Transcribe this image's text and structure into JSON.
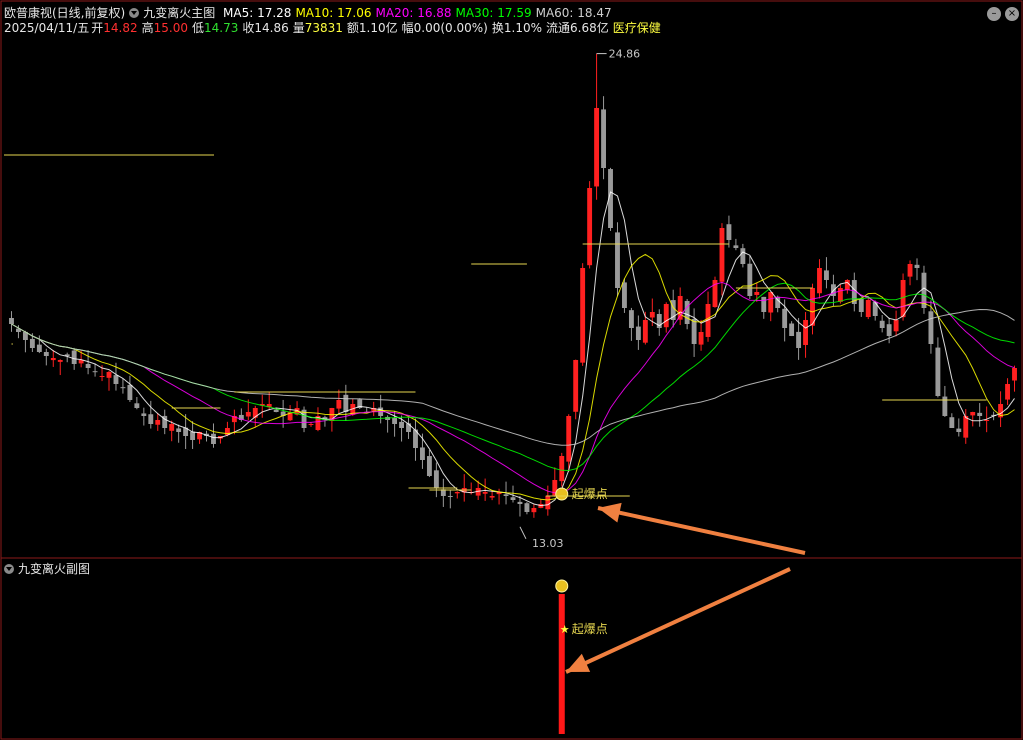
{
  "header": {
    "stock_name": "欧普康视(日线,前复权)",
    "indicator": "九变离火主图",
    "ma": [
      {
        "label": "MA5: 17.28",
        "color": "#ffffff"
      },
      {
        "label": "MA10: 17.06",
        "color": "#ffff00"
      },
      {
        "label": "MA20: 16.88",
        "color": "#ff00ff"
      },
      {
        "label": "MA30: 17.59",
        "color": "#00ff00"
      },
      {
        "label": "MA60: 18.47",
        "color": "#cfcfcf"
      }
    ],
    "date": "2025/04/11/五",
    "open_label": "开",
    "open": "14.82",
    "high_label": "高",
    "high": "15.00",
    "low_label": "低",
    "low": "14.73",
    "close_label": "收",
    "close": "14.86",
    "vol_label": "量",
    "vol": "73831",
    "amount": "额1.10亿",
    "change": "幅0.00(0.00%)",
    "turnover": "换1.10%",
    "float": "流通6.68亿",
    "sector": "医疗保健"
  },
  "sub_header": {
    "indicator": "九变离火副图"
  },
  "colors": {
    "up": "#ff2020",
    "down": "#9a9a9a",
    "level": "#e6d650",
    "arrow": "#f08040",
    "grid": "#8b1a1a"
  },
  "annotations": {
    "high_value": "24.86",
    "low_value": "13.03",
    "signal_label": "起爆点",
    "signal_label_sub": "起爆点"
  },
  "chart_data": [
    {
      "type": "candlestick",
      "title": "九变离火主图",
      "ylim": [
        12.5,
        25.2
      ],
      "x": "trading days (~120 bars)",
      "series": [
        {
          "name": "MA5",
          "last": 17.28
        },
        {
          "name": "MA10",
          "last": 17.06
        },
        {
          "name": "MA20",
          "last": 16.88
        },
        {
          "name": "MA30",
          "last": 17.59
        },
        {
          "name": "MA60",
          "last": 18.47
        }
      ],
      "closes": [
        18.1,
        17.9,
        17.7,
        17.5,
        17.4,
        17.3,
        17.25,
        17.2,
        17.3,
        17.1,
        17.2,
        17.0,
        16.9,
        16.8,
        16.9,
        16.6,
        16.5,
        16.2,
        16.0,
        15.8,
        15.6,
        15.7,
        15.5,
        15.6,
        15.4,
        15.3,
        15.2,
        15.4,
        15.3,
        15.1,
        15.3,
        15.5,
        15.8,
        15.7,
        15.9,
        16.0,
        16.1,
        16.1,
        15.9,
        15.8,
        15.9,
        16.0,
        15.5,
        15.6,
        15.8,
        15.7,
        16.0,
        16.2,
        15.9,
        16.1,
        16.0,
        15.9,
        16.0,
        15.8,
        15.7,
        15.6,
        15.5,
        15.4,
        15.0,
        14.7,
        14.3,
        14.0,
        13.8,
        13.8,
        13.9,
        14.0,
        13.9,
        14.0,
        13.9,
        13.8,
        13.9,
        13.8,
        13.7,
        13.6,
        13.4,
        13.5,
        13.6,
        13.8,
        14.2,
        14.8,
        15.8,
        17.2,
        19.5,
        21.5,
        23.5,
        22.0,
        20.5,
        19.0,
        18.5,
        18.0,
        17.7,
        18.2,
        18.4,
        18.0,
        18.6,
        18.2,
        18.8,
        18.1,
        17.6,
        17.9,
        18.6,
        19.2,
        20.5,
        20.2,
        20.0,
        19.6,
        18.8,
        18.9,
        18.4,
        18.9,
        18.5,
        18.0,
        17.8,
        17.5,
        18.2,
        19.0,
        19.5,
        19.2,
        18.8,
        19.0,
        19.2,
        18.6,
        18.4,
        18.7,
        18.3,
        18.0,
        17.8,
        18.2,
        19.2,
        19.6,
        19.5,
        18.5,
        17.6,
        16.3,
        15.8,
        15.5,
        15.4,
        15.8,
        15.9,
        15.8,
        15.7,
        15.8,
        16.1,
        16.6,
        17.0
      ],
      "marked_high": 24.86,
      "marked_low": 13.03,
      "signal": "起爆点"
    },
    {
      "type": "bar",
      "title": "九变离火副图",
      "signal": "起爆点"
    }
  ]
}
